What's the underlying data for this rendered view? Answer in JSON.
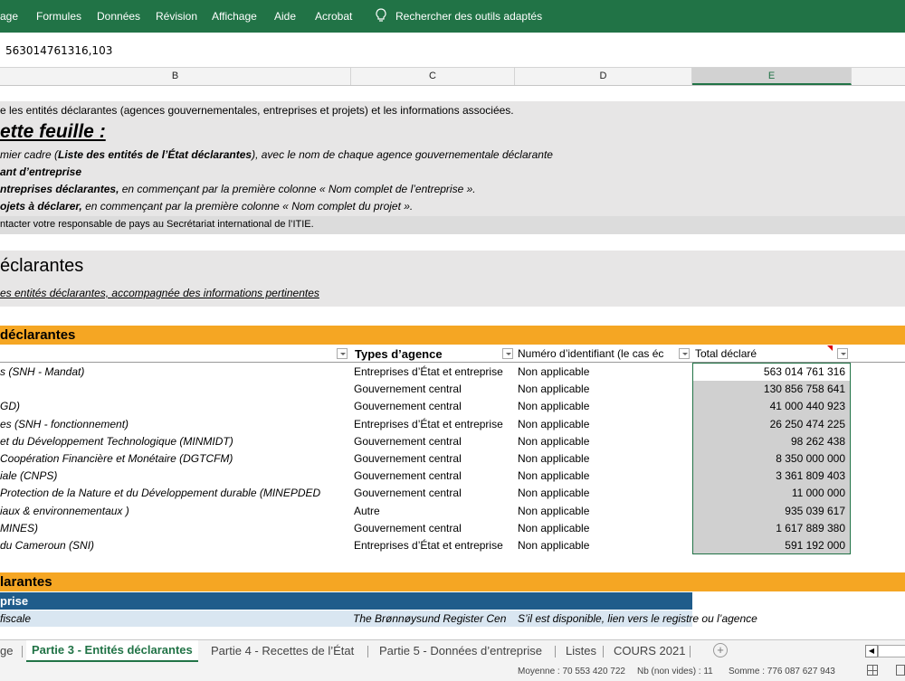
{
  "ribbon": {
    "tabs": [
      "age",
      "Formules",
      "Données",
      "Révision",
      "Affichage",
      "Aide",
      "Acrobat"
    ],
    "search": "Rechercher des outils adaptés"
  },
  "formula_bar": {
    "value": "563014761316,103"
  },
  "columns": [
    "B",
    "C",
    "D",
    "E"
  ],
  "intro": {
    "line1": "e les entités déclarantes (agences gouvernementales, entreprises et projets) et les informations associées.",
    "heading": "ette feuille :",
    "b1a": "mier cadre (",
    "b1b": "Liste des entités de l’État déclarantes",
    "b1c": "), avec le nom de chaque agence gouvernementale déclarante",
    "b2": "ant d’entreprise",
    "b3a": "ntreprises déclarantes,",
    "b3b": "  en commençant par la première colonne « Nom complet de l’entreprise ».",
    "b4a": "ojets à déclarer,",
    "b4b": "  en commençant par la première colonne « Nom complet du projet ».",
    "contact": "ntacter votre responsable de pays au Secrétariat international de l’ITIE."
  },
  "section": {
    "title": "éclarantes",
    "subtitle": "es entités déclarantes, accompagnée des informations pertinentes"
  },
  "table1": {
    "title": " déclarantes",
    "headers": {
      "b": "",
      "c": "Types d’agence",
      "d": "Numéro d’identifiant (le cas éc",
      "e": "Total déclaré"
    },
    "rows": [
      {
        "b": "s (SNH - Mandat)",
        "c": "Entreprises d’État et entreprise",
        "d": "Non applicable",
        "e": "563 014 761 316"
      },
      {
        "b": "",
        "c": "Gouvernement central",
        "d": "Non applicable",
        "e": "130 856 758 641"
      },
      {
        "b": "GD)",
        "c": "Gouvernement central",
        "d": "Non applicable",
        "e": "41 000 440 923"
      },
      {
        "b": "es (SNH - fonctionnement)",
        "c": "Entreprises d’État et entreprise",
        "d": "Non applicable",
        "e": "26 250 474 225"
      },
      {
        "b": "et du Développement Technologique (MINMIDT)",
        "c": "Gouvernement central",
        "d": "Non applicable",
        "e": "98 262 438"
      },
      {
        "b": "Coopération Financière et Monétaire (DGTCFM)",
        "c": "Gouvernement central",
        "d": "Non applicable",
        "e": "8 350 000 000"
      },
      {
        "b": "iale (CNPS)",
        "c": "Gouvernement central",
        "d": "Non applicable",
        "e": "3 361 809 403"
      },
      {
        "b": "Protection de la Nature et du Développement durable (MINEPDED",
        "c": "Gouvernement central",
        "d": "Non applicable",
        "e": "11 000 000"
      },
      {
        "b": "iaux & environnementaux )",
        "c": "Autre",
        "d": "Non applicable",
        "e": "935 039 617"
      },
      {
        "b": "MINES)",
        "c": "Gouvernement central",
        "d": "Non applicable",
        "e": "1 617 889 380"
      },
      {
        "b": "du Cameroun (SNI)",
        "c": "Entreprises d’État et entreprise",
        "d": "Non applicable",
        "e": "591 192 000"
      }
    ]
  },
  "table2": {
    "title": "larantes",
    "sub": "prise",
    "row_b": "fiscale",
    "row_c": "The Brønnøysund Register Cen",
    "row_d": "S’il est disponible, lien vers le registre ou l’agence"
  },
  "sheet_tabs": [
    "ge",
    "Partie 3 - Entités déclarantes",
    "Partie 4 - Recettes de l’État",
    "Partie 5 - Données d’entreprise",
    "Listes",
    "COURS 2021"
  ],
  "status": {
    "avg": "Moyenne : 70 553 420 722",
    "count": "Nb (non vides) : 11",
    "sum": "Somme : 776 087 627 943"
  }
}
